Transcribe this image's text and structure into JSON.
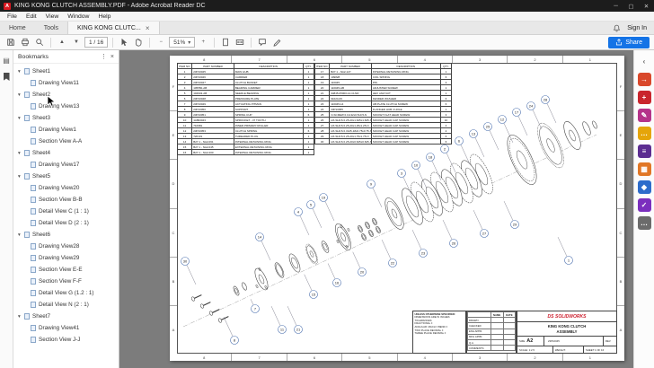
{
  "titlebar": {
    "title": "KING KONG CLUTCH ASSEMBLY.PDF - Adobe Acrobat Reader DC",
    "logo_glyph": "A",
    "win_min": "─",
    "win_max": "▢",
    "win_close": "✕"
  },
  "menubar": {
    "items": [
      "File",
      "Edit",
      "View",
      "Window",
      "Help"
    ]
  },
  "tabbar": {
    "home": "Home",
    "tools": "Tools",
    "doc": "KING KONG CLUTC...",
    "close": "×",
    "sign_in": "Sign In"
  },
  "toolbar": {
    "page_display": "1 / 16",
    "prev_glyph": "▲",
    "next_glyph": "▼",
    "zoom_out_glyph": "−",
    "zoom_in_glyph": "+",
    "zoom_caret": "▾",
    "zoom_level": "51%",
    "share_label": "Share"
  },
  "bookmarks_panel": {
    "title": "Bookmarks",
    "chevron_glyph": "▾",
    "options_glyph": "⋮",
    "close_glyph": "×",
    "items": [
      {
        "label": "Sheet1",
        "level": 0
      },
      {
        "label": "Drawing View11",
        "level": 1
      },
      {
        "label": "Sheet2",
        "level": 0
      },
      {
        "label": "Drawing View13",
        "level": 1
      },
      {
        "label": "Sheet3",
        "level": 0
      },
      {
        "label": "Drawing View1",
        "level": 1
      },
      {
        "label": "Section View A-A",
        "level": 1
      },
      {
        "label": "Sheet4",
        "level": 0
      },
      {
        "label": "Drawing View17",
        "level": 1
      },
      {
        "label": "Sheet5",
        "level": 0
      },
      {
        "label": "Drawing View20",
        "level": 1
      },
      {
        "label": "Section View B-B",
        "level": 1
      },
      {
        "label": "Detail View C (1 : 1)",
        "level": 1
      },
      {
        "label": "Detail View D (2 : 1)",
        "level": 1
      },
      {
        "label": "Sheet6",
        "level": 0
      },
      {
        "label": "Drawing View28",
        "level": 1
      },
      {
        "label": "Drawing View29",
        "level": 1
      },
      {
        "label": "Section View E-E",
        "level": 1
      },
      {
        "label": "Section View F-F",
        "level": 1
      },
      {
        "label": "Detail View G (1.2 : 1)",
        "level": 1
      },
      {
        "label": "Detail View N (2 : 1)",
        "level": 1
      },
      {
        "label": "Sheet7",
        "level": 0
      },
      {
        "label": "Drawing View41",
        "level": 1
      },
      {
        "label": "Section View J-J",
        "level": 1
      }
    ]
  },
  "right_tools": {
    "tools": [
      {
        "name": "collapse-panel-icon",
        "glyph": "‹",
        "bg": "",
        "fg": "#666"
      },
      {
        "name": "export-pdf-tool",
        "glyph": "→",
        "bg": "#d9482b",
        "fg": "#fff"
      },
      {
        "name": "create-pdf-tool",
        "glyph": "+",
        "bg": "#c9252d",
        "fg": "#fff"
      },
      {
        "name": "edit-pdf-tool",
        "glyph": "✎",
        "bg": "#b5338a",
        "fg": "#fff"
      },
      {
        "name": "comment-tool",
        "glyph": "…",
        "bg": "#e5a50a",
        "fg": "#fff"
      },
      {
        "name": "combine-files-tool",
        "glyph": "≡",
        "bg": "#5c2d91",
        "fg": "#fff"
      },
      {
        "name": "organize-pages-tool",
        "glyph": "▦",
        "bg": "#e17726",
        "fg": "#fff"
      },
      {
        "name": "protect-tool",
        "glyph": "◆",
        "bg": "#2d6ccb",
        "fg": "#fff"
      },
      {
        "name": "fill-sign-tool",
        "glyph": "✓",
        "bg": "#7b2fbe",
        "fg": "#fff"
      },
      {
        "name": "more-tools",
        "glyph": "…",
        "bg": "#6b6b6b",
        "fg": "#fff"
      }
    ]
  },
  "document": {
    "zones": {
      "top": [
        "8",
        "7",
        "6",
        "5",
        "4",
        "3",
        "2",
        "1"
      ],
      "bottom": [
        "8",
        "7",
        "6",
        "5",
        "4",
        "3",
        "2",
        "1"
      ],
      "left": [
        "F",
        "E",
        "D",
        "C",
        "B",
        "A"
      ],
      "right": [
        "F",
        "E",
        "D",
        "C",
        "B",
        "A"
      ]
    },
    "bom_left": {
      "headers": [
        "ITEM NO.",
        "PART NUMBER",
        "DESCRIPTION",
        "QTY."
      ],
      "rows": [
        [
          "1",
          "23P10045",
          "MAIN HUB",
          "1"
        ],
        [
          "2",
          "23P10046",
          "CARRIER",
          "1"
        ],
        [
          "3",
          "23P10047",
          "CLUTCH BASKET",
          "1"
        ],
        [
          "4",
          "105550-AB",
          "BEARING CARRIER",
          "1"
        ],
        [
          "5",
          "104943-AB",
          "NEEDLE BEARING",
          "1"
        ],
        [
          "6",
          "23P10048",
          "PRESSURE PLATE",
          "1"
        ],
        [
          "7",
          "23P10049",
          "ACTUATING PITMAN",
          "1"
        ],
        [
          "8",
          "23P10050",
          "SUPPORT",
          "1"
        ],
        [
          "9",
          "23P10051",
          "SPRING CUP",
          "6"
        ],
        [
          "10",
          "1A893043",
          "SPROCKET - 37 TOOTH",
          "1"
        ],
        [
          "11",
          "710981",
          "INNER PRIMARY ROLLER",
          "1"
        ],
        [
          "12",
          "23P10053",
          "CLUTCH SPRING",
          "6"
        ],
        [
          "13",
          "720131",
          "THREADED PLUG",
          "1"
        ],
        [
          "14",
          "B27.1 - NA2-061",
          "INTERNAL RETAINING RING",
          "1"
        ],
        [
          "15",
          "B27.1 - NA2-045",
          "EXTERNAL RETAINING RING",
          "1"
        ],
        [
          "16",
          "B27.1 - NA2-200",
          "INTERNAL RETAINING RING",
          "1"
        ]
      ]
    },
    "bom_right": {
      "headers": [
        "ITEM NO.",
        "PART NUMBER",
        "DESCRIPTION",
        "QTY."
      ],
      "rows": [
        [
          "17",
          "B27.1 - NA2-127",
          "INTERNAL RETAINING RING",
          "1"
        ],
        [
          "18",
          "109828",
          "COIL SPRING",
          "6"
        ],
        [
          "19",
          "110045",
          "PIN",
          "3"
        ],
        [
          "20",
          "110045-AB",
          "ADJUSTER SCREW",
          "1"
        ],
        [
          "21",
          "94845-05000-14-CLNR",
          "HEX JAM NUT",
          "1"
        ],
        [
          "22",
          "91024-06",
          "FENDER WASHER",
          "6"
        ],
        [
          "23",
          "110045-14",
          "AB PLATE CLUTCH SCREW",
          "6"
        ],
        [
          "24",
          "23P10055",
          "FLANGED HUB 4 HOLE",
          "1"
        ],
        [
          "25",
          "O-SCREW 0.19-32x0.5x0.5-N",
          "SOCKET FLAT HEAD SCREW",
          "3"
        ],
        [
          "26",
          "HX-SHCS 0.25-20x1.625x1.625-N",
          "SOCKET HEAD CAP SCREW",
          "10"
        ],
        [
          "27",
          "HX-SHCS 0.25-20x1.25x1.25-N",
          "SOCKET HEAD CAP SCREW",
          "4"
        ],
        [
          "28",
          "HX-SHCS 0.3125-18x0.75x0.75-N",
          "SOCKET HEAD CAP SCREW",
          "2"
        ],
        [
          "29",
          "HX-SHCS 0.25-20x1.75x1.75-N",
          "SOCKET HEAD CAP SCREW",
          "6"
        ],
        [
          "30",
          "HX-SHCS 0.25-20x0.625x0.625-N",
          "SOCKET HEAD CAP SCREW",
          "6"
        ]
      ]
    },
    "balloons": [
      [
        14,
        100,
        202
      ],
      [
        4,
        143,
        174
      ],
      [
        5,
        157,
        166
      ],
      [
        19,
        171,
        158
      ],
      [
        9,
        224,
        143
      ],
      [
        3,
        258,
        131
      ],
      [
        10,
        274,
        122
      ],
      [
        18,
        290,
        113
      ],
      [
        2,
        306,
        104
      ],
      [
        6,
        322,
        95
      ],
      [
        13,
        338,
        87
      ],
      [
        25,
        354,
        79
      ],
      [
        12,
        370,
        71
      ],
      [
        17,
        386,
        63
      ],
      [
        24,
        402,
        56
      ],
      [
        28,
        418,
        49
      ],
      [
        30,
        17,
        229
      ],
      [
        8,
        72,
        317
      ],
      [
        11,
        125,
        305
      ],
      [
        21,
        143,
        305
      ],
      [
        7,
        95,
        282
      ],
      [
        15,
        160,
        266
      ],
      [
        16,
        186,
        253
      ],
      [
        20,
        214,
        241
      ],
      [
        22,
        248,
        231
      ],
      [
        23,
        282,
        220
      ],
      [
        26,
        316,
        209
      ],
      [
        27,
        350,
        198
      ],
      [
        29,
        384,
        188
      ],
      [
        1,
        444,
        228
      ]
    ],
    "notes": {
      "lines": [
        "UNLESS OTHERWISE SPECIFIED:",
        "DIMENSIONS ARE IN INCHES",
        "TOLERANCES:",
        "FRACTIONAL ±",
        "ANGULAR: MACH ±  BEND ±",
        "TWO PLACE DECIMAL   ±",
        "THREE PLACE DECIMAL ±"
      ]
    },
    "approvals": {
      "headers": [
        "",
        "NAME",
        "DATE"
      ],
      "rows": [
        "DRAWN",
        "CHECKED",
        "ENG APPR.",
        "MFG APPR.",
        "Q.A.",
        "COMMENTS:"
      ]
    },
    "title_block": {
      "logo_prefix": "DS",
      "logo_text": "SOLIDWORKS",
      "title_line1": "KING KONG CLUTCH",
      "title_line2": "ASSEMBLY",
      "size_label": "SIZE",
      "size_value": "A2",
      "dwg_label": "DWG. NO.",
      "dwg_value": "23P10045",
      "rev_label": "REV",
      "scale_text": "SCALE: 1:2.5",
      "weight_text": "WEIGHT:",
      "sheet_text": "SHEET 1 OF 16"
    }
  }
}
